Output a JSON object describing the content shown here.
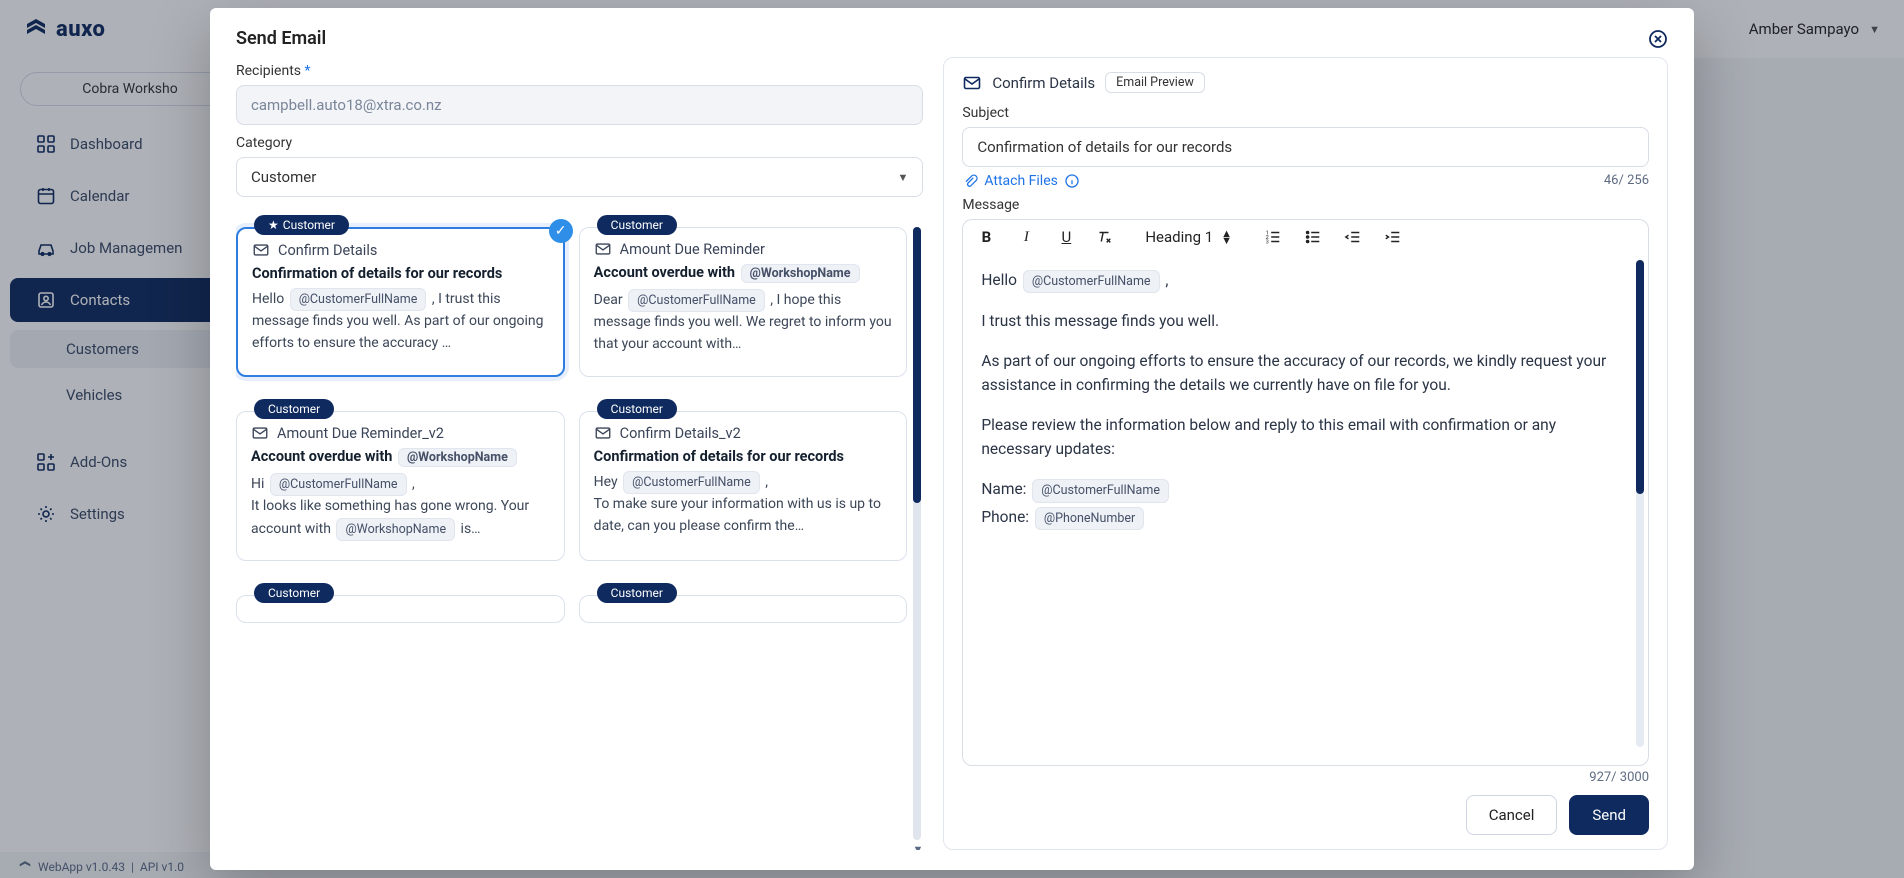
{
  "brand": "auxo",
  "workspace": "Cobra Worksho",
  "user": {
    "name": "Amber Sampayo"
  },
  "nav": {
    "dashboard": "Dashboard",
    "calendar": "Calendar",
    "job": "Job Managemen",
    "contacts": "Contacts",
    "customers": "Customers",
    "vehicles": "Vehicles",
    "addons": "Add-Ons",
    "settings": "Settings"
  },
  "footer": {
    "web": "WebApp v1.0.43",
    "api": "API  v1.0"
  },
  "dialog": {
    "title": "Send Email",
    "recipients_label": "Recipients",
    "recipients_value": "campbell.auto18@xtra.co.nz",
    "category_label": "Category",
    "category_value": "Customer",
    "templates": [
      {
        "tag": "Customer",
        "starred": true,
        "selected": true,
        "title": "Confirm Details",
        "subject": "Confirmation of details for our records",
        "pre1": "Hello ",
        "chip1": "@CustomerFullName",
        "post1": " , I trust this message finds you well. As part of our ongoing efforts to ensure the accuracy …"
      },
      {
        "tag": "Customer",
        "title": "Amount Due Reminder",
        "subject": "Account overdue with ",
        "subject_chip": "@WorkshopName",
        "pre1": "Dear ",
        "chip1": "@CustomerFullName",
        "post1": " , I hope this message finds you well. We regret to inform you that your account with…"
      },
      {
        "tag": "Customer",
        "title": "Amount Due Reminder_v2",
        "subject": "Account overdue with ",
        "subject_chip": "@WorkshopName",
        "pre1": "Hi ",
        "chip1": "@CustomerFullName",
        "post1": " ,",
        "line2a": "It looks like something has gone wrong. Your account with ",
        "line2chip": "@WorkshopName",
        "line2b": " is…"
      },
      {
        "tag": "Customer",
        "title": "Confirm Details_v2",
        "subject": "Confirmation of details for our records",
        "pre1": "Hey ",
        "chip1": "@CustomerFullName",
        "post1": " ,",
        "line2a": "To make sure your information with us is up to date, can you please confirm the…"
      },
      {
        "tag": "Customer"
      },
      {
        "tag": "Customer"
      }
    ],
    "right": {
      "confirm": "Confirm Details",
      "preview_pill": "Email Preview",
      "subject_label": "Subject",
      "subject_value": "Confirmation of details for our records",
      "subject_count": "46/ 256",
      "attach": "Attach Files",
      "message_label": "Message",
      "heading": "Heading 1",
      "msg": {
        "hello": "Hello ",
        "chip_name": "@CustomerFullName",
        "hello_tail": " ,",
        "p1": "I trust this message finds you well.",
        "p2": "As part of our ongoing efforts to ensure the accuracy of our records, we kindly request your assistance in confirming the details we currently have on file for you.",
        "p3": "Please review the information below and reply to this email with confirmation or any necessary updates:",
        "name_lbl": "Name: ",
        "phone_lbl": "Phone: ",
        "chip_phone": "@PhoneNumber"
      },
      "msg_count": "927/ 3000",
      "cancel": "Cancel",
      "send": "Send"
    }
  }
}
